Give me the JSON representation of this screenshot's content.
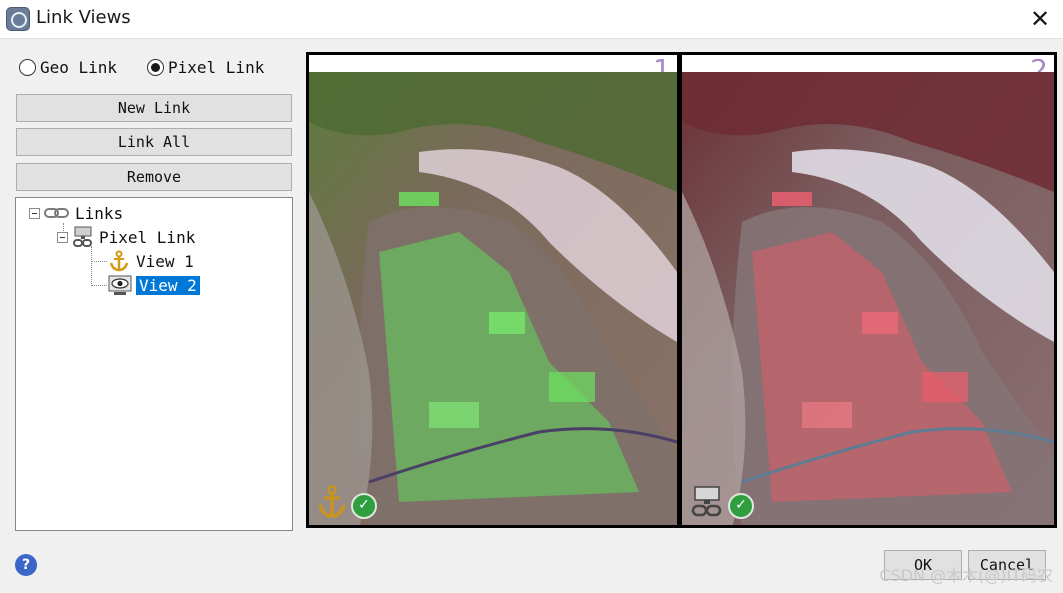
{
  "window": {
    "title": "Link Views",
    "close_symbol": "✕",
    "icons": {
      "app": "link-views-app-icon",
      "close": "close-icon"
    }
  },
  "link_type": {
    "options": [
      "Geo Link",
      "Pixel Link"
    ],
    "selected": "Pixel Link"
  },
  "buttons": {
    "new_link": "New Link",
    "link_all": "Link All",
    "remove": "Remove",
    "ok": "OK",
    "cancel": "Cancel",
    "help": "?"
  },
  "tree": {
    "root": {
      "label": "Links",
      "icon": "chain-link-icon"
    },
    "link": {
      "label": "Pixel Link",
      "icon": "pixel-link-icon"
    },
    "views": [
      {
        "label": "View 1",
        "icon": "anchor-icon",
        "selected": false
      },
      {
        "label": "View 2",
        "icon": "eye-icon",
        "selected": true
      }
    ]
  },
  "viewers": [
    {
      "number": "1",
      "badge_icon": "anchor-icon",
      "status_icon": "check-icon",
      "status_symbol": "✓"
    },
    {
      "number": "2",
      "badge_icon": "pixel-link-icon",
      "status_icon": "check-icon",
      "status_symbol": "✓"
    }
  ],
  "watermark": "CSDN @木木(@)IT码农",
  "colors": {
    "selection": "#0078d7",
    "view_number": "#a889c6",
    "check_green": "#2f9e3f",
    "help_blue": "#3a66c9"
  }
}
